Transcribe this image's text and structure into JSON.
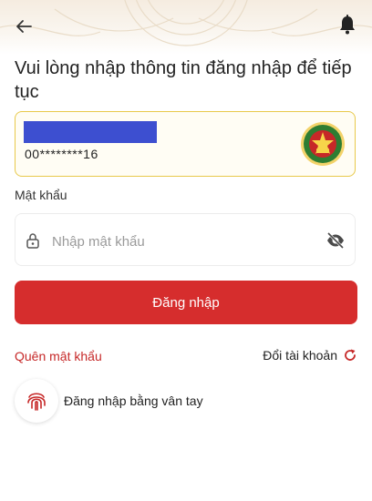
{
  "header": {
    "back_icon": "arrow-left-icon",
    "notification_icon": "bell-icon"
  },
  "title": "Vui lòng nhập thông tin đăng nhập để tiếp tục",
  "account": {
    "number": "00********16",
    "logo": "police-emblem-logo",
    "name_masked": true
  },
  "password": {
    "label": "Mật khẩu",
    "placeholder": "Nhập mật khẩu",
    "value": "",
    "lock_icon": "lock-icon",
    "visibility_icon": "eye-off-icon"
  },
  "login_button": {
    "label": "Đăng nhập"
  },
  "links": {
    "forgot_password": "Quên mật khẩu",
    "switch_account": "Đổi tài khoản"
  },
  "biometric": {
    "label": "Đăng nhập bằng vân tay",
    "icon": "fingerprint-icon"
  },
  "colors": {
    "primary_red": "#d62d2d",
    "link_red": "#c62828",
    "card_border": "#e8c94a",
    "mask_blue": "#3d4fd0"
  }
}
